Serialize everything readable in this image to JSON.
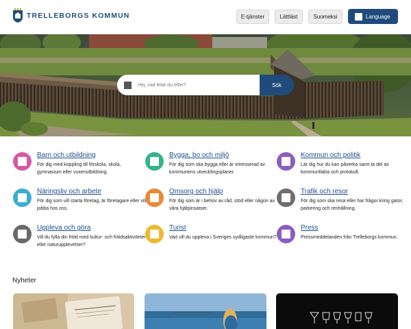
{
  "header": {
    "logo_text": "TRELLEBORGS KOMMUN",
    "nav": [
      "E-tjänster",
      "Lättläst",
      "Suomeksi"
    ],
    "language_label": "Language"
  },
  "search": {
    "placeholder": "Hej, vad letar du efter?",
    "button_label": "Sök"
  },
  "categories": [
    {
      "title": "Barn och utbildning",
      "desc": "För dig med koppling till förskola, skola, gymnasium eller vuxenutbildning.",
      "color": "#d35aa6"
    },
    {
      "title": "Bygga, bo och miljö",
      "desc": "För dig som ska bygga eller är intresserad av kommunens utvecklingsplaner.",
      "color": "#34b48a"
    },
    {
      "title": "Kommun och politik",
      "desc": "Lär dig hur du kan påverka samt ta del av kommunfakta och protokoll.",
      "color": "#8b5dc0"
    },
    {
      "title": "Näringsliv och arbete",
      "desc": "För dig som vill starta företag, är företagare eller vill jobba hos oss.",
      "color": "#3aaed0"
    },
    {
      "title": "Omsorg och hjälp",
      "desc": "För dig som är i behov av råd, stöd eller någon av våra hjälpinsatser.",
      "color": "#e8893a"
    },
    {
      "title": "Trafik och resor",
      "desc": "För dig som ska resa eller har frågor kring gator, parkering och renhållning.",
      "color": "#6e6e6e"
    },
    {
      "title": "Uppleva och göra",
      "desc": "Vill du fylla din fritid med kultur- och fritidsaktiviteter eller naturupplevelser?",
      "color": "#6a6a6a"
    },
    {
      "title": "Turist",
      "desc": "Vad vill du uppleva i Sveriges sydligaste kommun?",
      "color": "#efb82e"
    },
    {
      "title": "Press",
      "desc": "Pressmeddelanden från Trelleborgs kommun.",
      "color": "#8b5dc0"
    }
  ],
  "news": {
    "heading": "Nyheter"
  }
}
